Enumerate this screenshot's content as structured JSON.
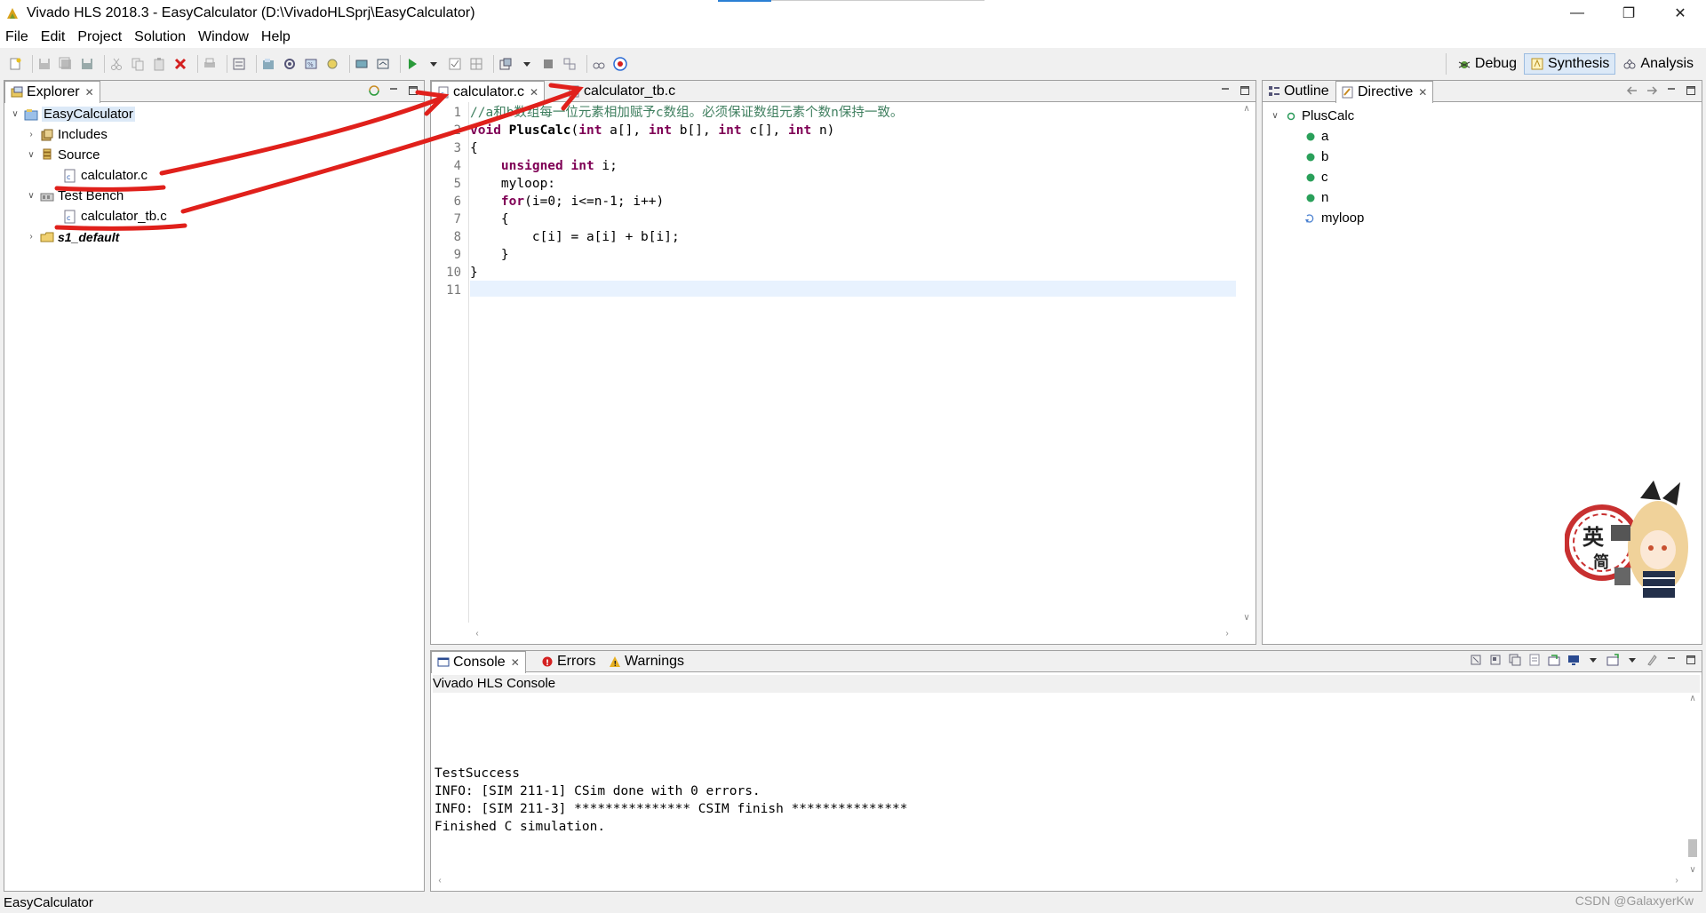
{
  "window": {
    "title": "Vivado HLS 2018.3 - EasyCalculator (D:\\VivadoHLSprj\\EasyCalculator)",
    "minimize": "—",
    "restore": "❐",
    "close": "✕"
  },
  "menu": [
    "File",
    "Edit",
    "Project",
    "Solution",
    "Window",
    "Help"
  ],
  "perspectives": [
    {
      "label": "Debug",
      "icon": "debug-icon"
    },
    {
      "label": "Synthesis",
      "icon": "synthesis-icon",
      "active": true
    },
    {
      "label": "Analysis",
      "icon": "analysis-icon"
    }
  ],
  "explorer": {
    "tab": "Explorer",
    "tree": [
      {
        "label": "EasyCalculator",
        "level": 0,
        "expanded": true,
        "icon": "project-icon",
        "selected": true
      },
      {
        "label": "Includes",
        "level": 1,
        "expanded": false,
        "icon": "includes-icon"
      },
      {
        "label": "Source",
        "level": 1,
        "expanded": true,
        "icon": "source-folder-icon"
      },
      {
        "label": "calculator.c",
        "level": 2,
        "icon": "c-file-icon"
      },
      {
        "label": "Test Bench",
        "level": 1,
        "expanded": true,
        "icon": "testbench-folder-icon"
      },
      {
        "label": "calculator_tb.c",
        "level": 2,
        "icon": "c-file-icon"
      },
      {
        "label": "s1_default",
        "level": 1,
        "expanded": false,
        "icon": "solution-icon",
        "bold_italic": true
      }
    ]
  },
  "editor": {
    "tabs": [
      {
        "label": "calculator.c",
        "active": true
      },
      {
        "label": "calculator_tb.c",
        "active": false
      }
    ],
    "lines": [
      {
        "n": "1",
        "text": "//a和b数组每一位元素相加赋予c数组。必须保证数组元素个数n保持一致。"
      },
      {
        "n": "2",
        "text": "void PlusCalc(int a[], int b[], int c[], int n)"
      },
      {
        "n": "3",
        "text": "{"
      },
      {
        "n": "4",
        "text": "    unsigned int i;"
      },
      {
        "n": "5",
        "text": "    myloop:"
      },
      {
        "n": "6",
        "text": "    for(i=0; i<=n-1; i++)"
      },
      {
        "n": "7",
        "text": "    {"
      },
      {
        "n": "8",
        "text": "        c[i] = a[i] + b[i];"
      },
      {
        "n": "9",
        "text": "    }"
      },
      {
        "n": "10",
        "text": "}"
      },
      {
        "n": "11",
        "text": ""
      }
    ]
  },
  "outline": {
    "tabs": [
      "Outline",
      "Directive"
    ],
    "tree": [
      {
        "label": "PlusCalc",
        "level": 0,
        "icon": "function-icon"
      },
      {
        "label": "a",
        "level": 1,
        "icon": "variable-icon"
      },
      {
        "label": "b",
        "level": 1,
        "icon": "variable-icon"
      },
      {
        "label": "c",
        "level": 1,
        "icon": "variable-icon"
      },
      {
        "label": "n",
        "level": 1,
        "icon": "variable-icon"
      },
      {
        "label": "myloop",
        "level": 1,
        "icon": "loop-icon"
      }
    ]
  },
  "console": {
    "tabs": [
      "Console",
      "Errors",
      "Warnings"
    ],
    "header": "Vivado HLS Console",
    "lines": [
      "TestSuccess",
      "INFO: [SIM 211-1] CSim done with 0 errors.",
      "INFO: [SIM 211-3] *************** CSIM finish ***************",
      "Finished C simulation."
    ]
  },
  "status": {
    "left": "EasyCalculator",
    "watermark": "CSDN @GalaxyerKw"
  },
  "sticker": {
    "text1": "英",
    "text2": "简"
  },
  "colors": {
    "accent": "#dce9f7",
    "annotation": "#e0201b",
    "keyword": "#7f0055",
    "comment": "#3f7f5f"
  }
}
